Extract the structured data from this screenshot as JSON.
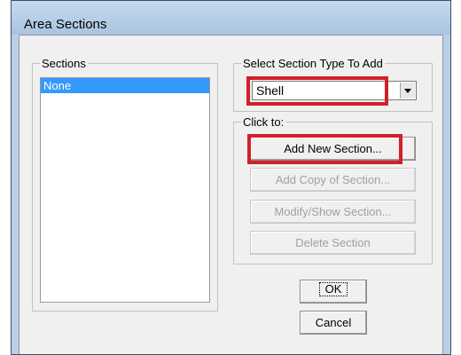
{
  "window": {
    "title": "Area Sections"
  },
  "sections_group": {
    "legend": "Sections",
    "items": [
      {
        "label": "None",
        "selected": true
      }
    ]
  },
  "type_group": {
    "legend": "Select Section Type To Add",
    "selected_value": "Shell"
  },
  "click_group": {
    "legend": "Click to:",
    "add_new": "Add New Section...",
    "add_copy": "Add Copy of Section...",
    "modify": "Modify/Show Section...",
    "delete": "Delete Section"
  },
  "buttons": {
    "ok": "OK",
    "cancel": "Cancel"
  },
  "colors": {
    "highlight": "#d31f2a",
    "selection": "#3399ff"
  }
}
